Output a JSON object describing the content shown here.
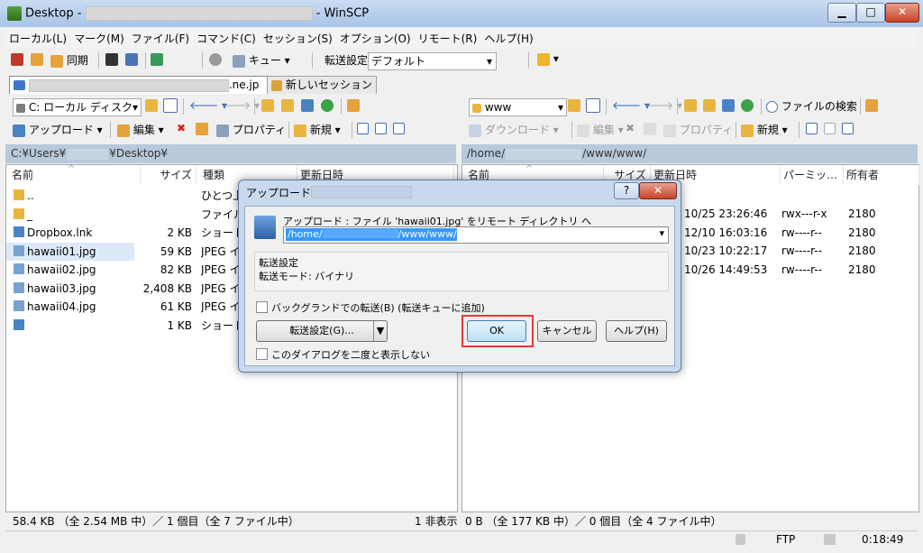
{
  "window": {
    "title_prefix": "Desktop -",
    "title_suffix": "- WinSCP",
    "controls": {
      "minimize": "▁",
      "maximize": "□",
      "close": "✕"
    }
  },
  "menu": [
    "ローカル(L)",
    "マーク(M)",
    "ファイル(F)",
    "コマンド(C)",
    "セッション(S)",
    "オプション(O)",
    "リモート(R)",
    "ヘルプ(H)"
  ],
  "toolbar": {
    "sync_label": "同期",
    "queue_label": "キュー",
    "transfer_settings_label": "転送設定",
    "transfer_settings_value": "デフォルト"
  },
  "tabs": {
    "session_suffix": ".ne.jp",
    "new_session": "新しいセッション"
  },
  "local": {
    "drive": "C: ローカル ディスク",
    "upload_label": "アップロード",
    "edit_label": "編集",
    "properties_label": "プロパティ",
    "new_label": "新規",
    "path_prefix": "C:¥Users¥",
    "path_suffix": "¥Desktop¥",
    "columns": [
      "名前",
      "サイズ",
      "種類",
      "更新日時"
    ],
    "rows": [
      {
        "name": "..",
        "size": "",
        "type": "ひとつ上"
      },
      {
        "name": "_",
        "size": "",
        "type": "ファイル"
      },
      {
        "name": "Dropbox.lnk",
        "size": "2 KB",
        "type": "ショート"
      },
      {
        "name": "hawaii01.jpg",
        "size": "59 KB",
        "type": "JPEG イ"
      },
      {
        "name": "hawaii02.jpg",
        "size": "82 KB",
        "type": "JPEG イ"
      },
      {
        "name": "hawaii03.jpg",
        "size": "2,408 KB",
        "type": "JPEG イ"
      },
      {
        "name": "hawaii04.jpg",
        "size": "61 KB",
        "type": "JPEG イ"
      },
      {
        "name": "",
        "size": "1 KB",
        "type": "ショート"
      }
    ],
    "status": "58.4 KB （全 2.54 MB 中）／ 1 個目（全 7 ファイル中）",
    "hidden": "1 非表示"
  },
  "remote": {
    "folder": "www",
    "download_label": "ダウンロード",
    "edit_label": "編集",
    "properties_label": "プロパティ",
    "new_label": "新規",
    "find_label": "ファイルの検索",
    "path_prefix": "/home/",
    "path_suffix": "/www/www/",
    "columns": [
      "名前",
      "サイズ",
      "更新日時",
      "パーミッ…",
      "所有者"
    ],
    "rows": [
      {
        "date": "10/25 23:26:46",
        "perm": "rwx---r-x",
        "owner": "2180"
      },
      {
        "date": "12/10 16:03:16",
        "perm": "rw----r--",
        "owner": "2180"
      },
      {
        "date": "10/23 10:22:17",
        "perm": "rw----r--",
        "owner": "2180"
      },
      {
        "date": "10/26 14:49:53",
        "perm": "rw----r--",
        "owner": "2180"
      }
    ],
    "status": "0 B （全 177 KB 中）／ 0 個目（全 4 ファイル中）"
  },
  "statusbar": {
    "protocol": "FTP",
    "time": "0:18:49"
  },
  "dialog": {
    "title": "アップロード",
    "help_glyph": "?",
    "close_glyph": "✕",
    "message": "アップロード : ファイル 'hawaii01.jpg' をリモート ディレクトリ へ",
    "target_prefix": "/home/",
    "target_suffix": "/www/www/*.*",
    "settings_title": "転送設定",
    "settings_mode": "転送モード: バイナリ",
    "background_label": "バックグランドでの転送(B) (転送キューに追加)",
    "transfer_settings_button": "転送設定(G)...",
    "ok": "OK",
    "cancel": "キャンセル",
    "help": "ヘルプ(H)",
    "dont_show_label": "このダイアログを二度と表示しない"
  },
  "colors": {
    "title_gradient_top": "#c9dcf2",
    "highlight_red": "#e53935",
    "selection": "#3399ff",
    "pathbar": "#b8c9dc"
  }
}
